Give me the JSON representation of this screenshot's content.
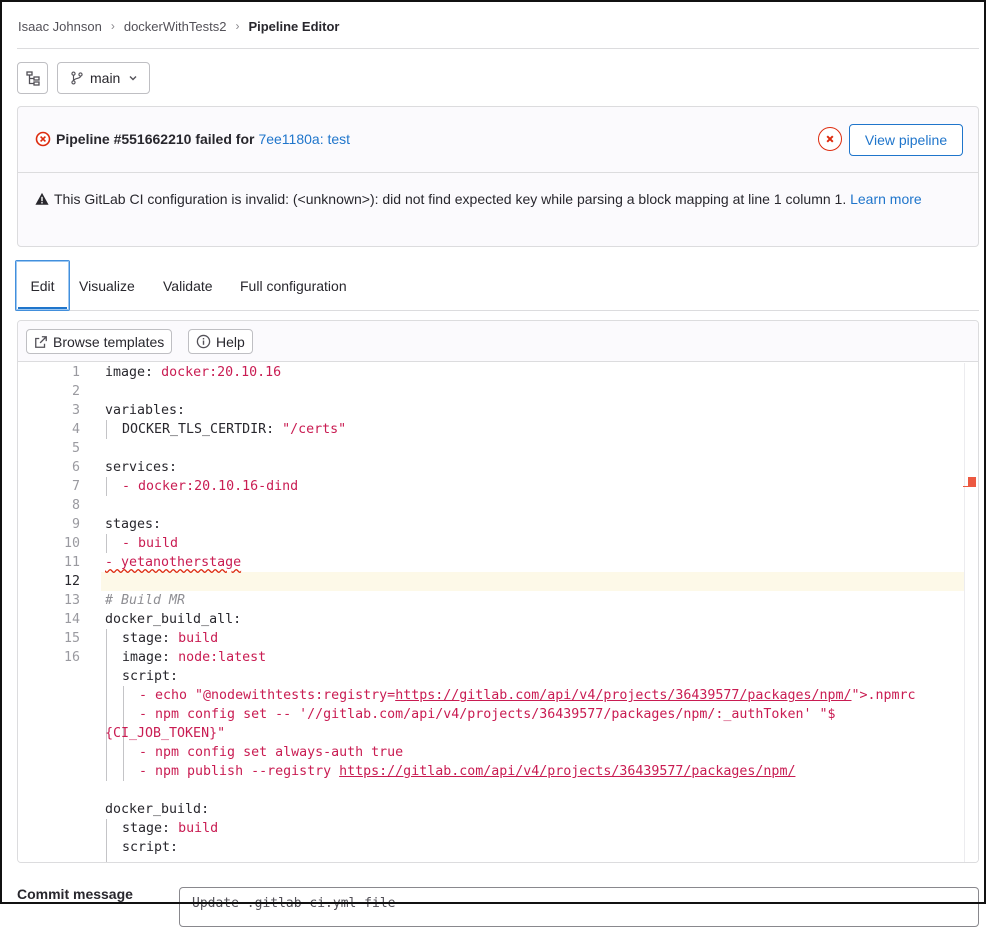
{
  "breadcrumb": {
    "items": [
      "Isaac Johnson",
      "dockerWithTests2"
    ],
    "current": "Pipeline Editor"
  },
  "branch": {
    "name": "main"
  },
  "status": {
    "prefix": "Pipeline #551662210 failed for",
    "commit": "7ee1180a: test",
    "view_button": "View pipeline"
  },
  "warning": {
    "text": "This GitLab CI configuration is invalid: (<unknown>): did not find expected key while parsing a block mapping at line 1 column 1.",
    "link": "Learn more"
  },
  "tabs": [
    "Edit",
    "Visualize",
    "Validate",
    "Full configuration"
  ],
  "editor_toolbar": {
    "browse": "Browse templates",
    "help": "Help"
  },
  "editor": {
    "line_numbers": [
      "1",
      "2",
      "3",
      "4",
      "5",
      "6",
      "7",
      "8",
      "9",
      "10",
      "11",
      "12",
      "13",
      "14",
      "15",
      "16"
    ],
    "current_line": "12",
    "lines": {
      "l1_key": "image:",
      "l1_val": "docker:20.10.16",
      "l3_key": "variables:",
      "l4_key": "DOCKER_TLS_CERTDIR:",
      "l4_val": "\"/certs\"",
      "l6_key": "services:",
      "l7_dash": "-",
      "l7_val": "docker:20.10.16-dind",
      "l9_key": "stages:",
      "l10_dash": "-",
      "l10_val": "build",
      "l11": "- yetanotherstage",
      "l13": "# Build MR",
      "l14_key": "docker_build_all:",
      "l15_key": "stage:",
      "l15_val": "build",
      "l16_key": "image:",
      "l16_val": "node:latest",
      "l17_key": "script:",
      "l18_pre": "- echo \"@nodewithtests:registry=",
      "l18_url": "https://gitlab.com/api/v4/projects/36439577/packages/npm/",
      "l18_post": "\">.npmrc",
      "l19": "- npm config set -- '//gitlab.com/api/v4/projects/36439577/packages/npm/:_authToken' \"$",
      "l20": "{CI_JOB_TOKEN}\"",
      "l21": "- npm config set always-auth true",
      "l22_pre": "- npm publish --registry ",
      "l22_url": "https://gitlab.com/api/v4/projects/36439577/packages/npm/",
      "l24_key": "docker_build:",
      "l25_key": "stage:",
      "l25_val": "build",
      "l26_key": "script:"
    }
  },
  "commit": {
    "label": "Commit message",
    "value": "Update .gitlab-ci.yml file"
  }
}
